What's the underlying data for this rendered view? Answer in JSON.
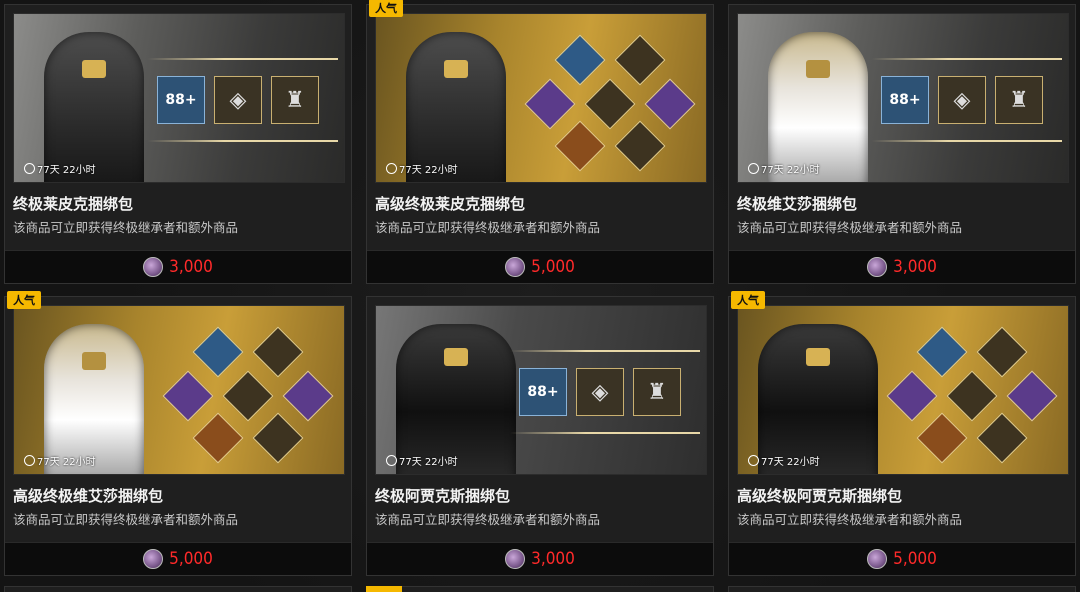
{
  "colors": {
    "price_red": "#ff2a2a",
    "badge_yellow": "#f5b800"
  },
  "products": [
    {
      "title": "终极莱皮克捆绑包",
      "desc": "该商品可立即获得终极继承者和额外商品",
      "price": "3,000",
      "timer": "77天 22小时",
      "badge": "",
      "theme": "gray",
      "figure": "dark",
      "layout": "tiles"
    },
    {
      "title": "高级终极莱皮克捆绑包",
      "desc": "该商品可立即获得终极继承者和额外商品",
      "price": "5,000",
      "timer": "77天 22小时",
      "badge": "人气",
      "theme": "gold",
      "figure": "dark",
      "layout": "diamonds"
    },
    {
      "title": "终极维艾莎捆绑包",
      "desc": "该商品可立即获得终极继承者和额外商品",
      "price": "3,000",
      "timer": "77天 22小时",
      "badge": "",
      "theme": "gray",
      "figure": "white",
      "layout": "tiles"
    },
    {
      "title": "高级终极维艾莎捆绑包",
      "desc": "该商品可立即获得终极继承者和额外商品",
      "price": "5,000",
      "timer": "77天 22小时",
      "badge": "人气",
      "theme": "gold",
      "figure": "white",
      "layout": "diamonds"
    },
    {
      "title": "终极阿贾克斯捆绑包",
      "desc": "该商品可立即获得终极继承者和额外商品",
      "price": "3,000",
      "timer": "77天 22小时",
      "badge": "",
      "theme": "dark",
      "figure": "black",
      "layout": "tiles"
    },
    {
      "title": "高级终极阿贾克斯捆绑包",
      "desc": "该商品可立即获得终极继承者和额外商品",
      "price": "5,000",
      "timer": "77天 22小时",
      "badge": "人气",
      "theme": "gold",
      "figure": "black",
      "layout": "diamonds"
    }
  ],
  "icons": {
    "currency": "caliber-coin-icon",
    "timer": "clock-icon"
  }
}
